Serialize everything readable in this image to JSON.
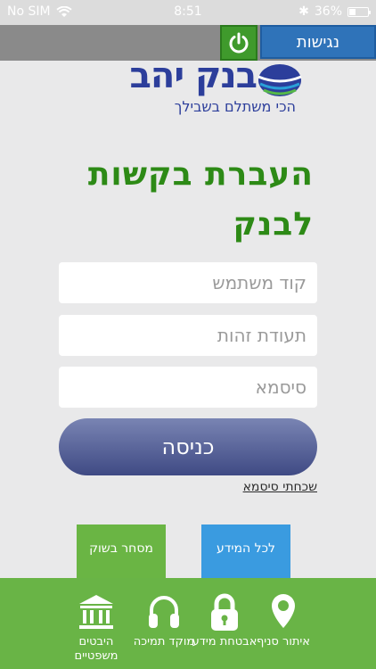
{
  "status_bar": {
    "carrier": "No SIM",
    "time": "8:51",
    "battery": "36%",
    "battery_level": 0.36
  },
  "toolbar": {
    "access_label": "נגישות"
  },
  "logo": {
    "name": "בנק יהב",
    "slogan": "הכי משתלם בשבילך"
  },
  "title": "העברת בקשות לבנק",
  "form": {
    "user_code_placeholder": "קוד משתמש",
    "id_placeholder": "תעודת זהות",
    "password_placeholder": "סיסמא",
    "login_label": "כניסה",
    "forgot_label": "שכחתי סיסמא"
  },
  "tiles": {
    "trade": "מסחר בשוק",
    "info": "לכל המידע"
  },
  "bottom_nav": [
    {
      "icon": "location-pin-icon",
      "label": "איתור סניף"
    },
    {
      "icon": "lock-icon",
      "label": "אבטחת מידע"
    },
    {
      "icon": "headphones-icon",
      "label": "מוקד תמיכה"
    },
    {
      "icon": "courthouse-icon",
      "label": "היבטים משפטיים"
    }
  ]
}
